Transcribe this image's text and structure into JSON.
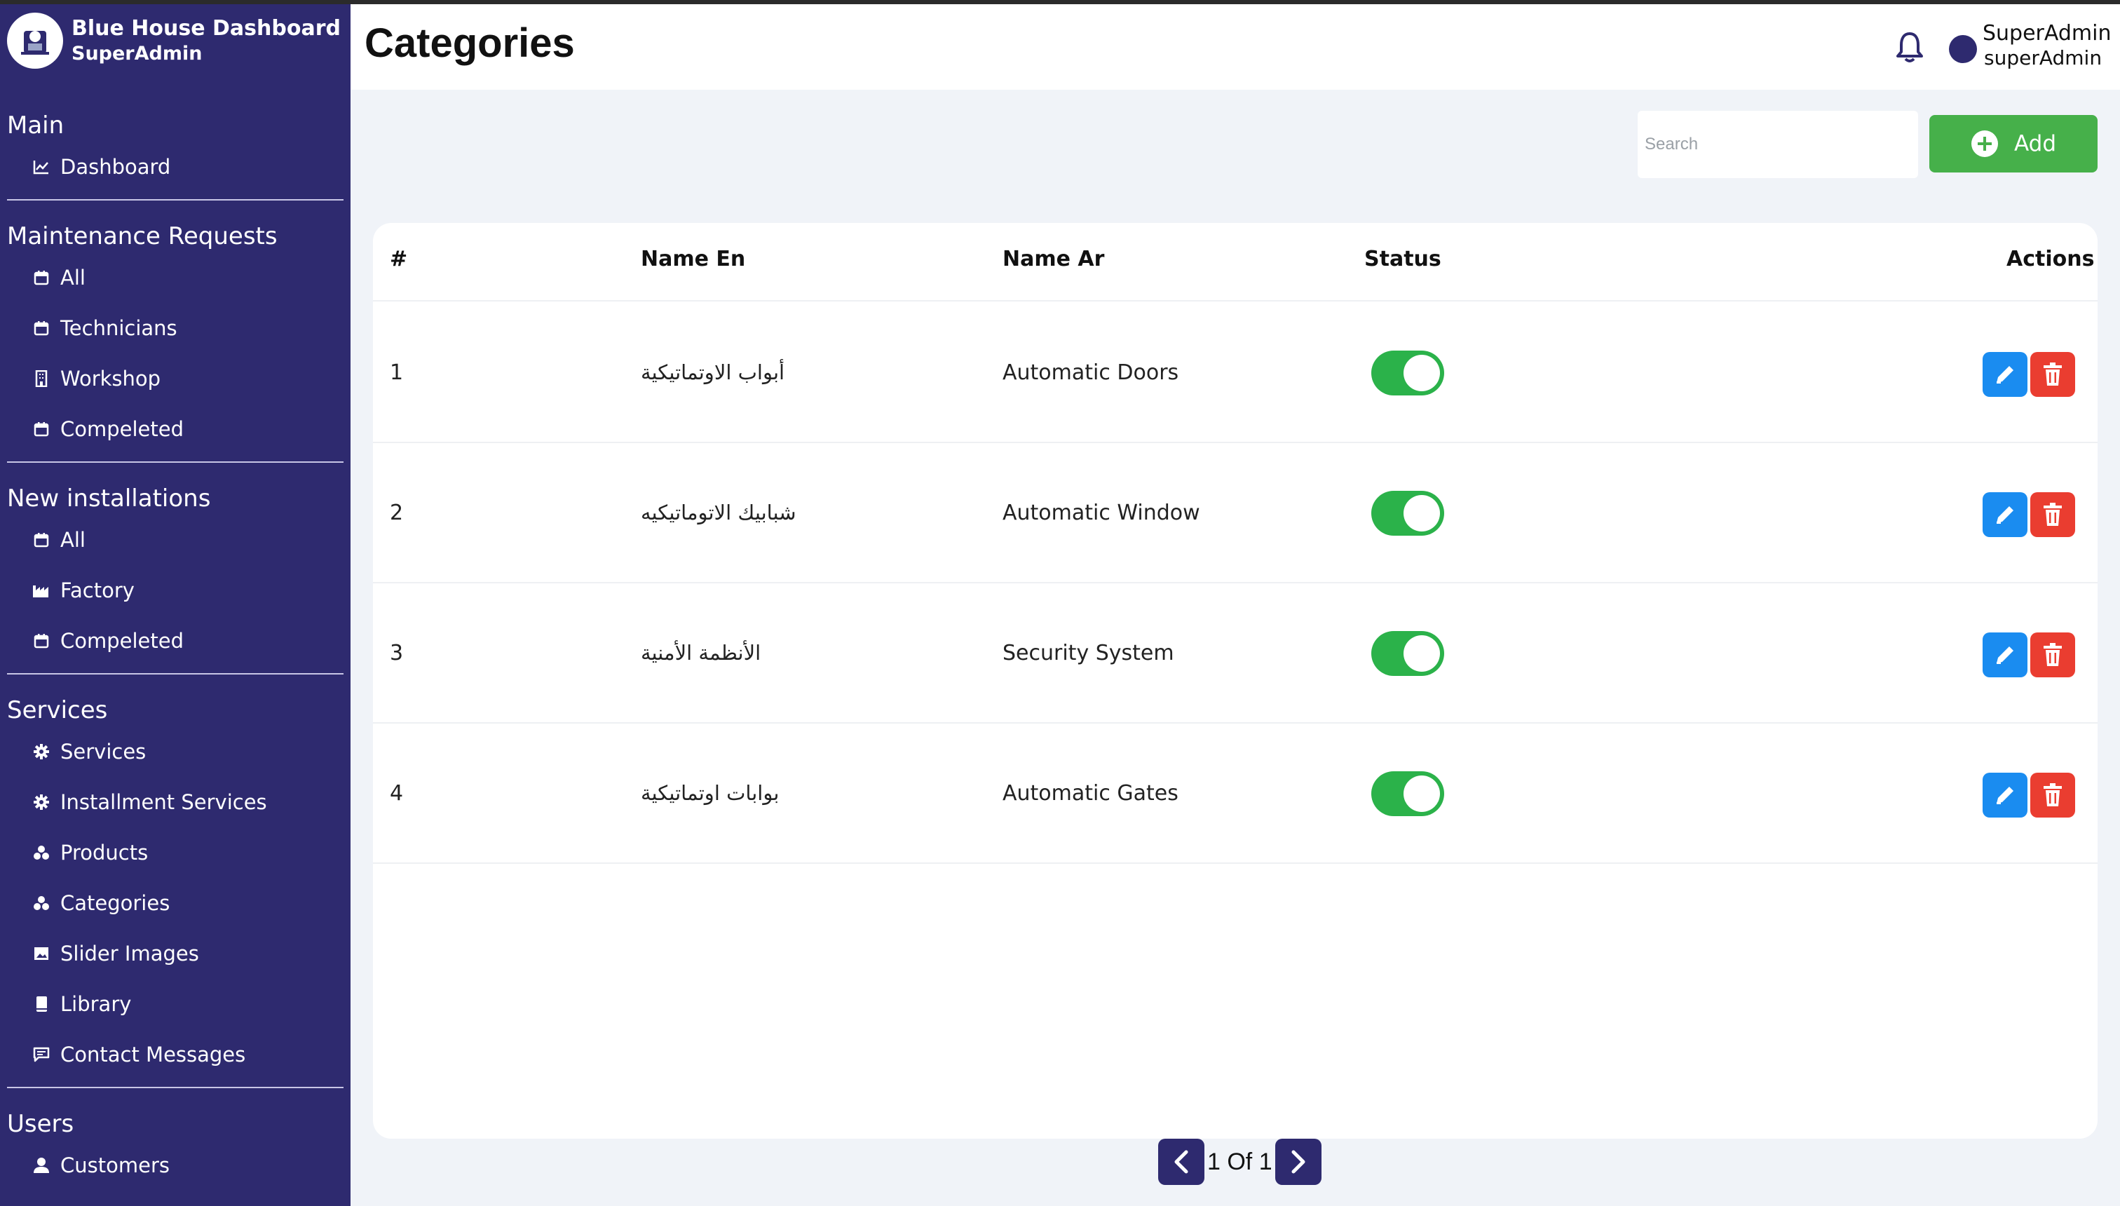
{
  "brand": {
    "title": "Blue House Dashboard",
    "subtitle": "SuperAdmin"
  },
  "sidebar": {
    "sections": [
      {
        "title": "Main",
        "items": [
          {
            "label": "Dashboard",
            "icon": "chart-line-icon"
          }
        ]
      },
      {
        "title": "Maintenance Requests",
        "items": [
          {
            "label": "All",
            "icon": "calendar-icon"
          },
          {
            "label": "Technicians",
            "icon": "calendar-icon"
          },
          {
            "label": "Workshop",
            "icon": "building-icon"
          },
          {
            "label": "Compeleted",
            "icon": "calendar-icon"
          }
        ]
      },
      {
        "title": "New installations",
        "items": [
          {
            "label": "All",
            "icon": "calendar-icon"
          },
          {
            "label": "Factory",
            "icon": "factory-icon"
          },
          {
            "label": "Compeleted",
            "icon": "calendar-icon"
          }
        ]
      },
      {
        "title": "Services",
        "items": [
          {
            "label": "Services",
            "icon": "gear-icon"
          },
          {
            "label": "Installment Services",
            "icon": "gear-icon"
          },
          {
            "label": "Products",
            "icon": "shapes-icon"
          },
          {
            "label": "Categories",
            "icon": "shapes-icon"
          },
          {
            "label": "Slider Images",
            "icon": "image-icon"
          },
          {
            "label": "Library",
            "icon": "book-icon"
          },
          {
            "label": "Contact Messages",
            "icon": "message-icon"
          }
        ]
      },
      {
        "title": "Users",
        "items": [
          {
            "label": "Customers",
            "icon": "person-icon"
          }
        ]
      }
    ]
  },
  "header": {
    "title": "Categories",
    "user_name": "SuperAdmin",
    "user_role": "superAdmin"
  },
  "toolbar": {
    "search_placeholder": "Search",
    "add_label": "Add"
  },
  "table": {
    "columns": [
      "#",
      "Name En",
      "Name Ar",
      "Status",
      "Actions"
    ],
    "rows": [
      {
        "num": "1",
        "name_en": "أبواب الاوتماتيكية",
        "name_ar": "Automatic Doors",
        "status": true
      },
      {
        "num": "2",
        "name_en": "شبابيك الاتوماتيكيه",
        "name_ar": "Automatic Window",
        "status": true
      },
      {
        "num": "3",
        "name_en": "الأنظمة الأمنية",
        "name_ar": "Security System",
        "status": true
      },
      {
        "num": "4",
        "name_en": "بوابات اوتماتيكية",
        "name_ar": "Automatic Gates",
        "status": true
      }
    ]
  },
  "pagination": {
    "text": "1 Of 1"
  },
  "colors": {
    "sidebar": "#2e2a6f",
    "add": "#46b04a",
    "toggle_on": "#2bb24a",
    "edit": "#1a8cf0",
    "delete": "#ea3d30"
  }
}
